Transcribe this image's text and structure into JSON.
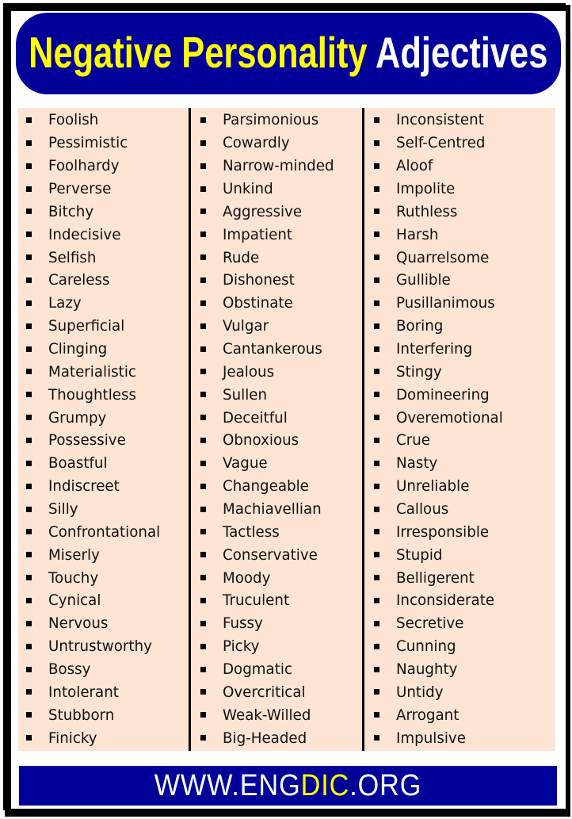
{
  "header": {
    "title_part1": "Negative Personality",
    "title_part2": "Adjectives"
  },
  "columns": [
    {
      "items": [
        "Foolish",
        "Pessimistic",
        "Foolhardy",
        "Perverse",
        "Bitchy",
        "Indecisive",
        "Selfish",
        "Careless",
        "Lazy",
        "Superficial",
        "Clinging",
        "Materialistic",
        "Thoughtless",
        "Grumpy",
        "Possessive",
        "Boastful",
        "Indiscreet",
        "Silly",
        "Confrontational",
        "Miserly",
        "Touchy",
        "Cynical",
        "Nervous",
        "Untrustworthy",
        "Bossy",
        "Intolerant",
        "Stubborn",
        "Finicky"
      ]
    },
    {
      "items": [
        "Parsimonious",
        "Cowardly",
        "Narrow-minded",
        "Unkind",
        "Aggressive",
        "Impatient",
        "Rude",
        "Dishonest",
        "Obstinate",
        "Vulgar",
        "Cantankerous",
        "Jealous",
        "Sullen",
        "Deceitful",
        "Obnoxious",
        "Vague",
        "Changeable",
        "Machiavellian",
        "Tactless",
        "Conservative",
        "Moody",
        "Truculent",
        "Fussy",
        "Picky",
        "Dogmatic",
        "Overcritical",
        "Weak-Willed",
        "Big-Headed"
      ]
    },
    {
      "items": [
        "Inconsistent",
        "Self-Centred",
        "Aloof",
        "Impolite",
        "Ruthless",
        "Harsh",
        "Quarrelsome",
        "Gullible",
        "Pusillanimous",
        "Boring",
        "Interfering",
        "Stingy",
        "Domineering",
        "Overemotional",
        "Crue",
        "Nasty",
        "Unreliable",
        "Callous",
        "Irresponsible",
        "Stupid",
        "Belligerent",
        "Inconsiderate",
        "Secretive",
        "Cunning",
        "Naughty",
        "Untidy",
        "Arrogant",
        "Impulsive"
      ]
    }
  ],
  "footer": {
    "url_prefix": "WWW.ENG",
    "url_accent": "DIC",
    "url_suffix": ".ORG"
  },
  "colors": {
    "banner_blue": "#000099",
    "title_yellow": "#ffff00",
    "list_background": "#fde4d3",
    "frame_black": "#000000"
  }
}
